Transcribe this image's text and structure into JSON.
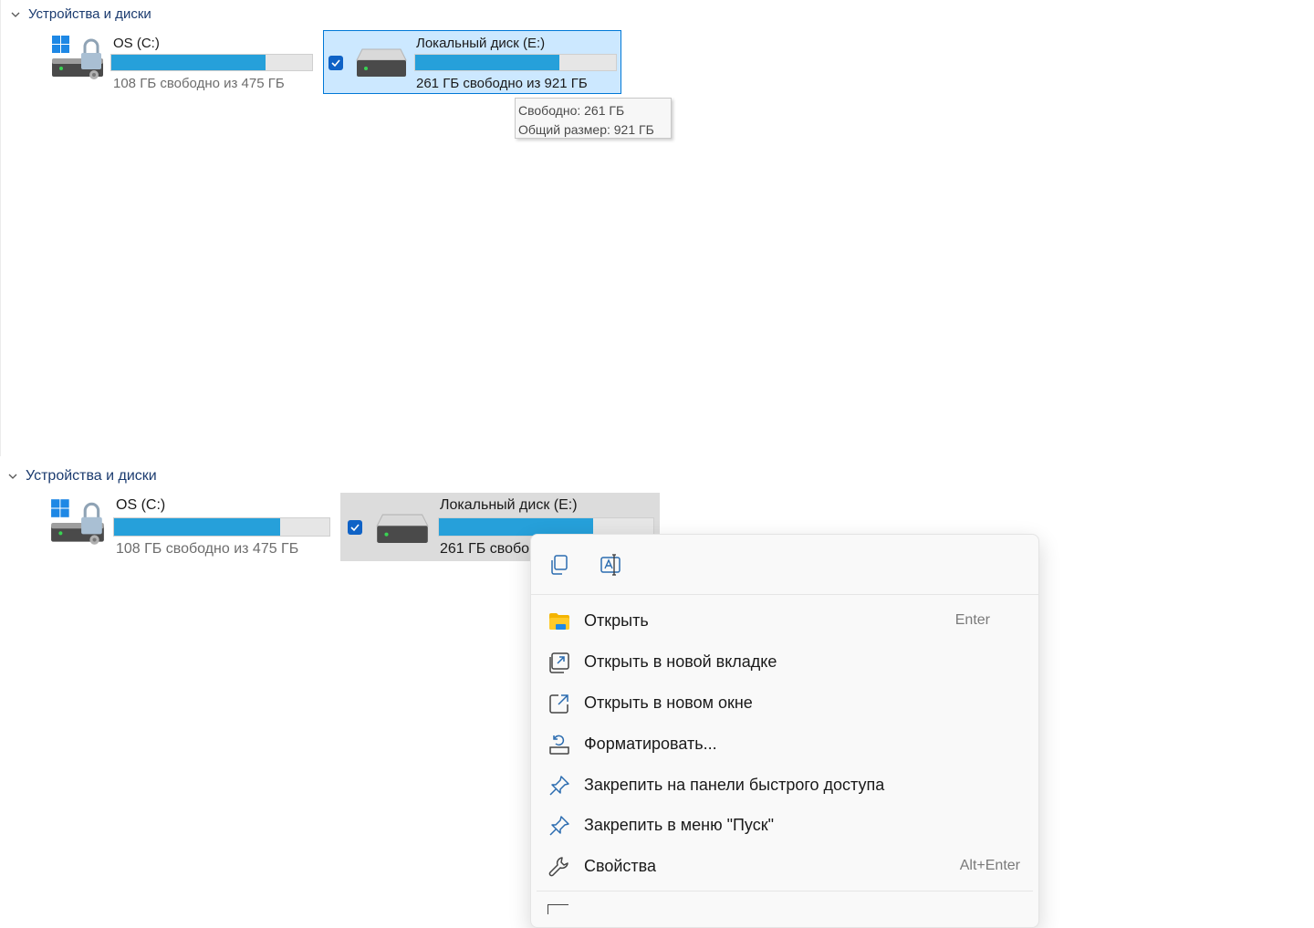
{
  "top_panel": {
    "section_title": "Устройства и диски",
    "drives": [
      {
        "name": "OS (C:)",
        "free_text": "108 ГБ свободно из 475 ГБ",
        "used_fraction": 0.77
      },
      {
        "name": "Локальный диск (E:)",
        "free_text": "261 ГБ свободно из 921 ГБ",
        "used_fraction": 0.72,
        "selected": true
      }
    ],
    "tooltip": {
      "line1": "Свободно: 261 ГБ",
      "line2": "Общий размер: 921 ГБ"
    }
  },
  "bottom_panel": {
    "section_title": "Устройства и диски",
    "drives": [
      {
        "name": "OS (C:)",
        "free_text": "108 ГБ свободно из 475 ГБ",
        "used_fraction": 0.77
      },
      {
        "name": "Локальный диск (E:)",
        "free_text": "261 ГБ свобо",
        "used_fraction": 0.72,
        "selected": true
      }
    ]
  },
  "context_menu": {
    "quick_actions": [
      {
        "icon": "copy-icon"
      },
      {
        "icon": "rename-icon"
      }
    ],
    "items": [
      {
        "label": "Открыть",
        "accel": "Enter",
        "icon": "folder-icon"
      },
      {
        "label": "Открыть в новой вкладке",
        "accel": "",
        "icon": "new-tab-icon"
      },
      {
        "label": "Открыть в новом окне",
        "accel": "",
        "icon": "new-window-icon"
      },
      {
        "label": "Форматировать...",
        "accel": "",
        "icon": "format-icon"
      },
      {
        "label": "Закрепить на панели быстрого доступа",
        "accel": "",
        "icon": "pin-icon"
      },
      {
        "label": "Закрепить в меню \"Пуск\"",
        "accel": "",
        "icon": "pin-icon"
      },
      {
        "label": "Свойства",
        "accel": "Alt+Enter",
        "icon": "wrench-icon"
      }
    ]
  },
  "colors": {
    "accent": "#0078d7",
    "bar_fill": "#26a0da",
    "selection_bg": "#cce8ff",
    "header_text": "#1b3b6f"
  }
}
